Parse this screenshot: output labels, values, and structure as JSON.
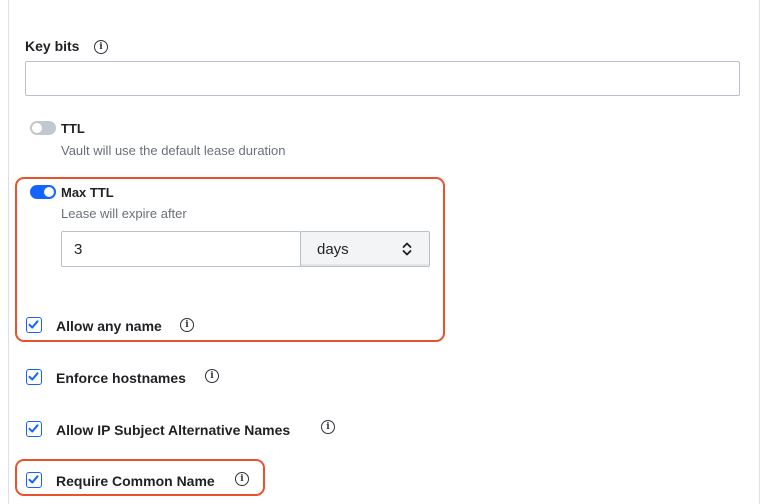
{
  "key_bits": {
    "label": "Key bits",
    "value": ""
  },
  "ttl": {
    "label": "TTL",
    "help": "Vault will use the default lease duration",
    "enabled": false
  },
  "max_ttl": {
    "label": "Max TTL",
    "help": "Lease will expire after",
    "enabled": true,
    "value": "3",
    "unit": "days"
  },
  "checkboxes": {
    "allow_any_name": {
      "label": "Allow any name",
      "checked": true
    },
    "enforce_hostnames": {
      "label": "Enforce hostnames",
      "checked": true
    },
    "allow_ip_sans": {
      "label": "Allow IP Subject Alternative Names",
      "checked": true
    },
    "require_cn": {
      "label": "Require Common Name",
      "checked": true
    }
  },
  "colors": {
    "accent": "#1563ff",
    "highlight": "#e8532b",
    "toggle_off": "#c2c8d0"
  },
  "icons": [
    "info-icon",
    "checkmark-icon",
    "chevron-up-down-icon"
  ]
}
